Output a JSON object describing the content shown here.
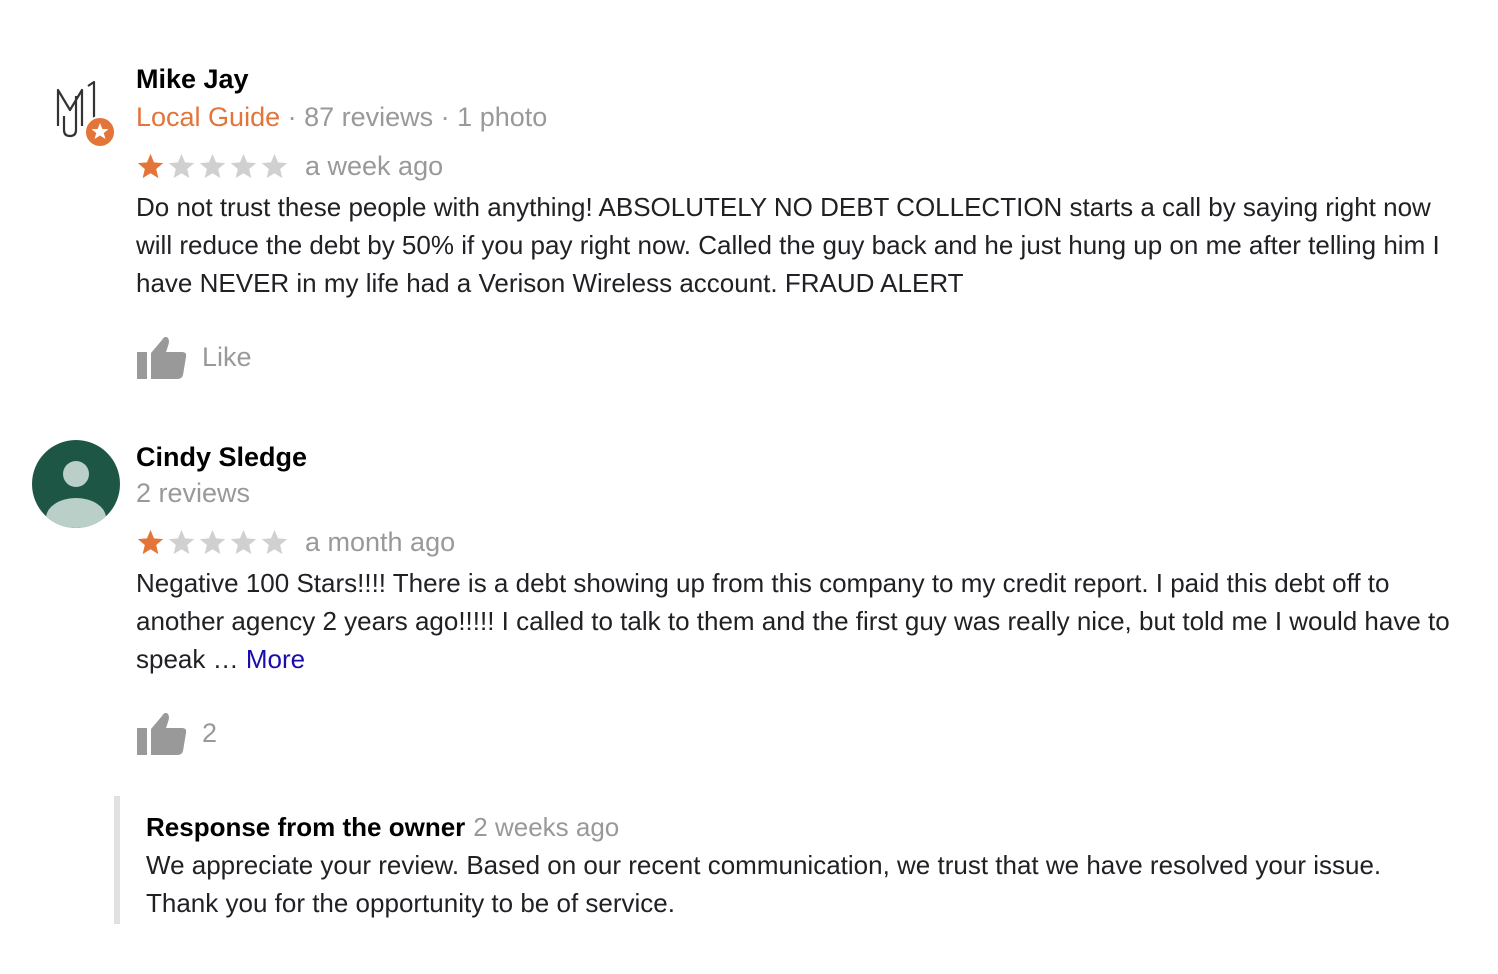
{
  "reviews": [
    {
      "name": "Mike Jay",
      "badge": "Local Guide",
      "sep1": " · ",
      "review_count": "87 reviews",
      "sep2": " · ",
      "photo_count": "1 photo",
      "rating": 1,
      "rating_max": 5,
      "time": "a week ago",
      "text": "Do not trust these people with anything! ABSOLUTELY NO DEBT COLLECTION starts a call by saying right now will reduce the debt by 50% if you pay right now. Called the guy back and he just hung up on me after telling him I have NEVER in my life had a Verison Wireless account. FRAUD ALERT",
      "like_label": "Like",
      "avatar_icon": "mj-monogram-local-guide-avatar"
    },
    {
      "name": "Cindy Sledge",
      "review_count": "2 reviews",
      "rating": 1,
      "rating_max": 5,
      "time": "a month ago",
      "text": "Negative 100 Stars!!!! There is a debt showing up from this company to my credit report. I paid this debt off to another agency 2 years ago!!!!! I called to talk to them and the first guy was really nice, but told me I would have to speak … ",
      "more_label": "More",
      "like_count": "2",
      "avatar_icon": "default-person-avatar"
    }
  ],
  "owner_response": {
    "title": "Response from the owner",
    "time": "2 weeks ago",
    "text": "We appreciate your review. Based on our recent communication, we trust that we have resolved your issue. Thank you for the opportunity to be of service."
  },
  "colors": {
    "star_filled": "#e3743a",
    "star_empty": "#d0d0d0",
    "local_guide": "#e3743a",
    "link": "#1a0dab",
    "muted": "#999999",
    "avatar_bg": "#1e5645"
  }
}
